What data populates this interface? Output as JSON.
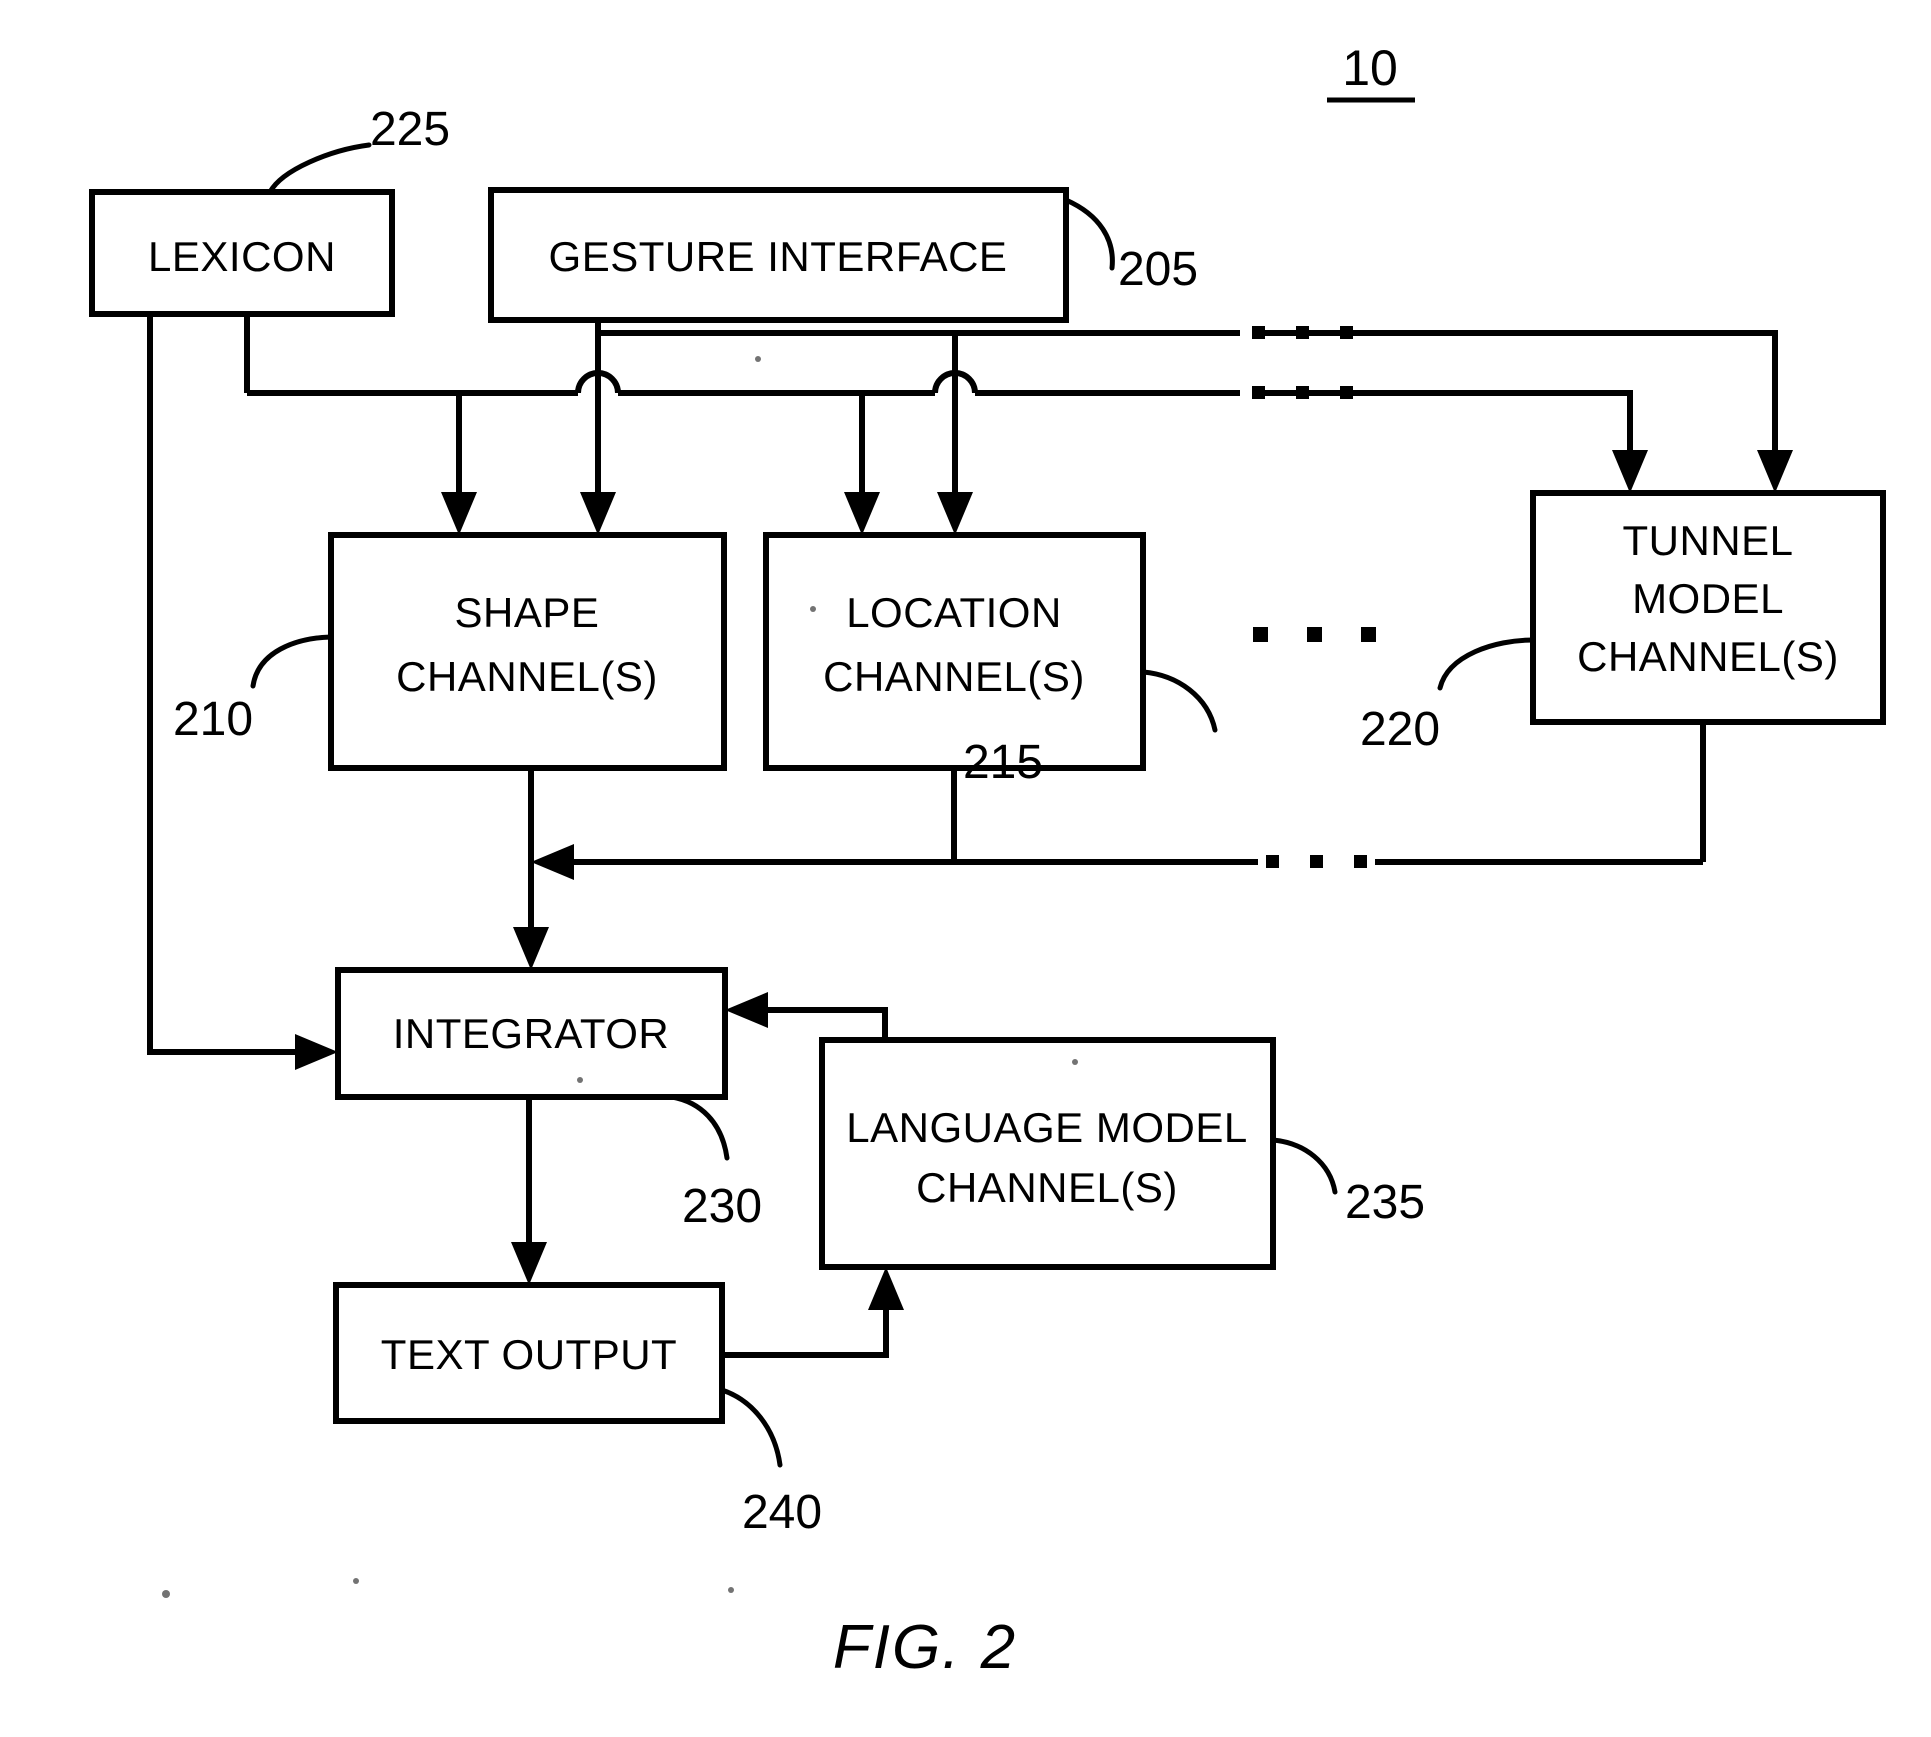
{
  "figure": {
    "caption": "FIG. 2",
    "system_label": "10"
  },
  "blocks": {
    "lexicon": {
      "label": "LEXICON",
      "ref": "225"
    },
    "gesture": {
      "label": "GESTURE INTERFACE",
      "ref": "205"
    },
    "shape": {
      "line1": "SHAPE",
      "line2": "CHANNEL(S)",
      "ref": "210"
    },
    "location": {
      "line1": "LOCATION",
      "line2": "CHANNEL(S)",
      "ref": "215"
    },
    "tunnel": {
      "line1": "TUNNEL",
      "line2": "MODEL",
      "line3": "CHANNEL(S)",
      "ref": "220"
    },
    "integrator": {
      "label": "INTEGRATOR",
      "ref": "230"
    },
    "language_model": {
      "line1": "LANGUAGE MODEL",
      "line2": "CHANNEL(S)",
      "ref": "235"
    },
    "text_output": {
      "label": "TEXT OUTPUT",
      "ref": "240"
    }
  },
  "colors": {
    "ink": "#000000",
    "paper": "#ffffff"
  }
}
